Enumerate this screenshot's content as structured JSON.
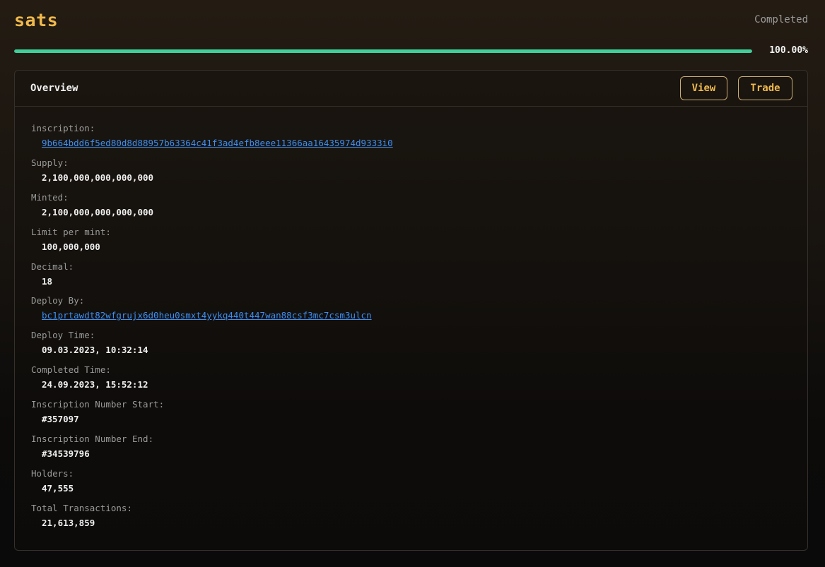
{
  "header": {
    "title": "sats",
    "status": "Completed"
  },
  "progress": {
    "percent_label": "100.00%",
    "value_fraction": 1.0,
    "color": "#3ecf9a"
  },
  "card": {
    "title": "Overview",
    "view_label": "View",
    "trade_label": "Trade"
  },
  "fields": {
    "inscription": {
      "label": "inscription:",
      "value": "9b664bdd6f5ed80d8d88957b63364c41f3ad4efb8eee11366aa16435974d9333i0"
    },
    "supply": {
      "label": "Supply:",
      "value": "2,100,000,000,000,000"
    },
    "minted": {
      "label": "Minted:",
      "value": "2,100,000,000,000,000"
    },
    "limit_per_mint": {
      "label": "Limit per mint:",
      "value": "100,000,000"
    },
    "decimal": {
      "label": "Decimal:",
      "value": "18"
    },
    "deploy_by": {
      "label": "Deploy By:",
      "value": "bc1prtawdt82wfgrujx6d0heu0smxt4yykq440t447wan88csf3mc7csm3ulcn"
    },
    "deploy_time": {
      "label": "Deploy Time:",
      "value": "09.03.2023, 10:32:14"
    },
    "completed_time": {
      "label": "Completed Time:",
      "value": "24.09.2023, 15:52:12"
    },
    "inscription_number_start": {
      "label": "Inscription Number Start:",
      "value": "#357097"
    },
    "inscription_number_end": {
      "label": "Inscription Number End:",
      "value": "#34539796"
    },
    "holders": {
      "label": "Holders:",
      "value": "47,555"
    },
    "total_transactions": {
      "label": "Total Transactions:",
      "value": "21,613,859"
    }
  }
}
